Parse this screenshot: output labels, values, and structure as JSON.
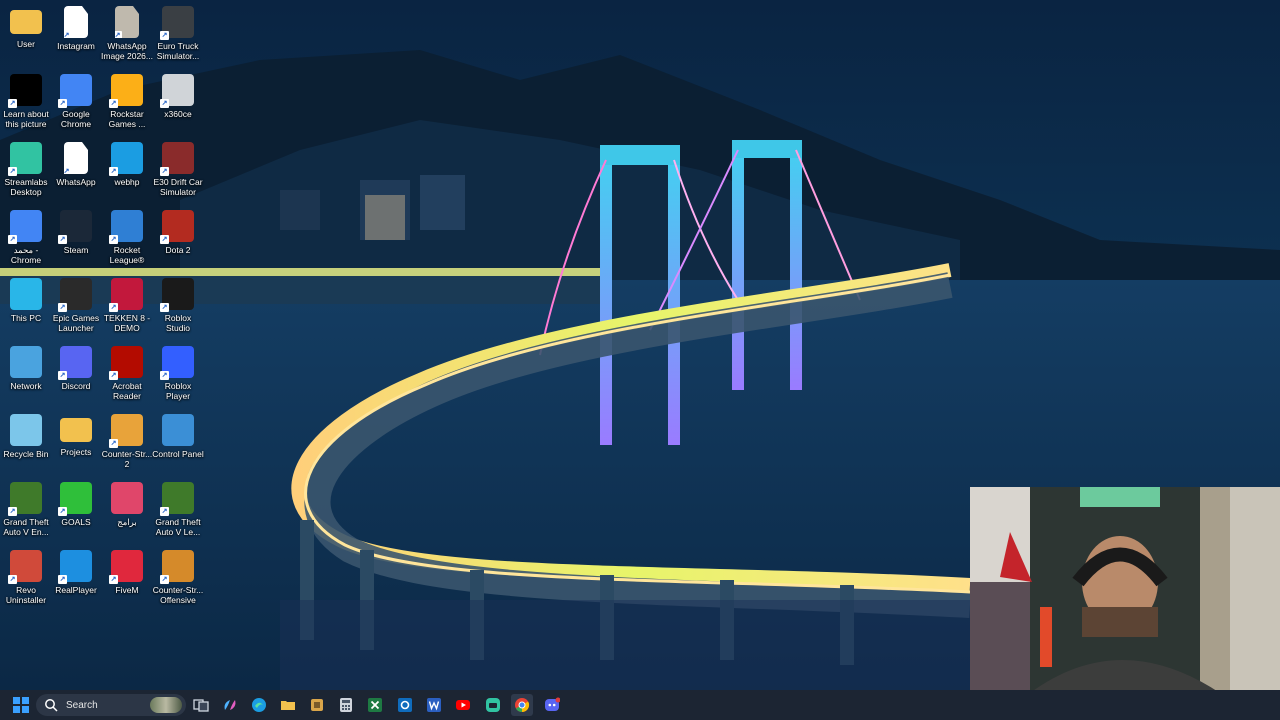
{
  "desktop": {
    "icons": [
      {
        "label": "User",
        "icon": "folder-icon",
        "color": "#f2c14e"
      },
      {
        "label": "Instagram",
        "icon": "file-icon",
        "color": "#ffffff"
      },
      {
        "label": "WhatsApp Image 2026...",
        "icon": "image-file-icon",
        "color": "#bfb9ad"
      },
      {
        "label": "Euro Truck Simulator...",
        "icon": "truck-icon",
        "color": "#3a3f44"
      },
      {
        "label": "Learn about this picture",
        "icon": "camera-icon",
        "color": "#000000"
      },
      {
        "label": "Google Chrome",
        "icon": "chrome-icon",
        "color": "#4285f4"
      },
      {
        "label": "Rockstar Games ...",
        "icon": "rockstar-icon",
        "color": "#fcaf17"
      },
      {
        "label": "x360ce",
        "icon": "gamepad-icon",
        "color": "#d0d4d8"
      },
      {
        "label": "Streamlabs Desktop",
        "icon": "streamlabs-icon",
        "color": "#31c3a2"
      },
      {
        "label": "WhatsApp",
        "icon": "file-icon",
        "color": "#ffffff"
      },
      {
        "label": "webhp",
        "icon": "edge-icon",
        "color": "#1b9de2"
      },
      {
        "label": "E30 Drift Car Simulator",
        "icon": "car-icon",
        "color": "#8a2b2b"
      },
      {
        "label": "محمد - Chrome",
        "icon": "chrome-profile-icon",
        "color": "#4285f4"
      },
      {
        "label": "Steam",
        "icon": "steam-icon",
        "color": "#1b2838"
      },
      {
        "label": "Rocket League®",
        "icon": "rocket-league-icon",
        "color": "#2f7fd4"
      },
      {
        "label": "Dota 2",
        "icon": "dota-icon",
        "color": "#b32b20"
      },
      {
        "label": "This PC",
        "icon": "monitor-icon",
        "color": "#29b6e8"
      },
      {
        "label": "Epic Games Launcher",
        "icon": "epic-icon",
        "color": "#2a2a2a"
      },
      {
        "label": "TEKKEN 8 - DEMO",
        "icon": "tekken-icon",
        "color": "#c2183c"
      },
      {
        "label": "Roblox Studio",
        "icon": "roblox-studio-icon",
        "color": "#1a1a1a"
      },
      {
        "label": "Network",
        "icon": "network-icon",
        "color": "#4aa3df"
      },
      {
        "label": "Discord",
        "icon": "discord-icon",
        "color": "#5865f2"
      },
      {
        "label": "Acrobat Reader",
        "icon": "acrobat-icon",
        "color": "#b30b00"
      },
      {
        "label": "Roblox Player",
        "icon": "roblox-icon",
        "color": "#335fff"
      },
      {
        "label": "Recycle Bin",
        "icon": "recycle-bin-icon",
        "color": "#7cc6ea"
      },
      {
        "label": "Projects",
        "icon": "folder-icon",
        "color": "#f2c14e"
      },
      {
        "label": "Counter-Str... 2",
        "icon": "counter-strike-icon",
        "color": "#e8a33a"
      },
      {
        "label": "Control Panel",
        "icon": "control-panel-icon",
        "color": "#3b8fd6"
      },
      {
        "label": "Grand Theft Auto V En...",
        "icon": "gta-icon",
        "color": "#3f7a2a"
      },
      {
        "label": "GOALS",
        "icon": "goals-icon",
        "color": "#2fbf3a"
      },
      {
        "label": "برامج",
        "icon": "apps-folder-icon",
        "color": "#e0466a"
      },
      {
        "label": "Grand Theft Auto V Le...",
        "icon": "gta-icon",
        "color": "#3f7a2a"
      },
      {
        "label": "Revo Uninstaller",
        "icon": "revo-icon",
        "color": "#d04a3a"
      },
      {
        "label": "RealPlayer",
        "icon": "realplayer-icon",
        "color": "#1d8fe0"
      },
      {
        "label": "FiveM",
        "icon": "fivem-icon",
        "color": "#e0283d"
      },
      {
        "label": "Counter-Str... Offensive",
        "icon": "counter-strike-icon",
        "color": "#d58a2a"
      }
    ]
  },
  "taskbar": {
    "search_placeholder": "Search",
    "items": [
      {
        "name": "start-button",
        "icon": "windows-icon"
      },
      {
        "name": "task-view-button",
        "icon": "task-view-icon"
      },
      {
        "name": "copilot-button",
        "icon": "copilot-icon"
      },
      {
        "name": "edge-taskbar-button",
        "icon": "edge-icon"
      },
      {
        "name": "file-explorer-button",
        "icon": "folder-icon"
      },
      {
        "name": "app-taskbar-button",
        "icon": "app-icon"
      },
      {
        "name": "calculator-taskbar-button",
        "icon": "calculator-icon"
      },
      {
        "name": "excel-taskbar-button",
        "icon": "excel-icon"
      },
      {
        "name": "outlook-taskbar-button",
        "icon": "outlook-icon"
      },
      {
        "name": "word-taskbar-button",
        "icon": "word-icon"
      },
      {
        "name": "youtube-taskbar-button",
        "icon": "youtube-icon"
      },
      {
        "name": "streamlabs-taskbar-button",
        "icon": "streamlabs-icon"
      },
      {
        "name": "chrome-taskbar-button",
        "icon": "chrome-icon"
      },
      {
        "name": "discord-taskbar-button",
        "icon": "discord-icon"
      }
    ]
  },
  "colors": {
    "taskbar_bg": "#1c2533",
    "accent": "#0078d4"
  }
}
